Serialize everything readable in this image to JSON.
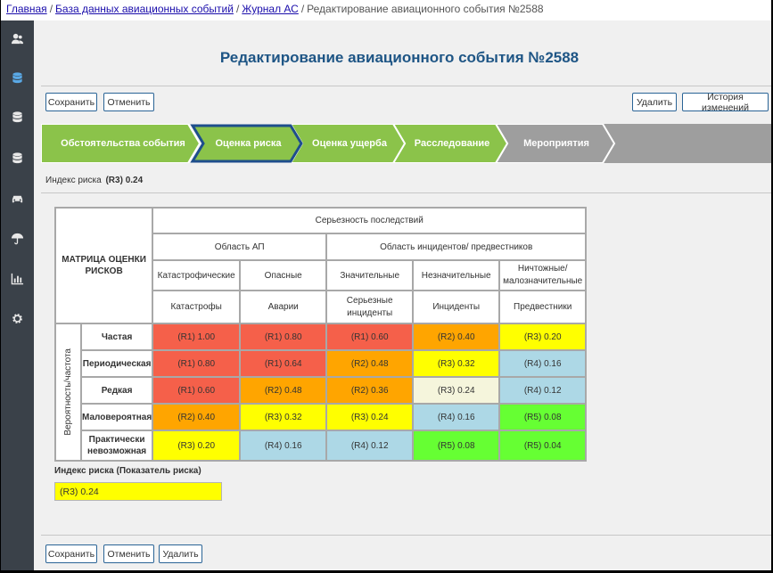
{
  "breadcrumb": {
    "items": [
      "Главная",
      "База данных авиационных событий",
      "Журнал АС"
    ],
    "current": "Редактирование авиационного события №2588"
  },
  "sidebar": {
    "icons": [
      "users-icon",
      "database-icon",
      "database-icon",
      "database-icon",
      "car-icon",
      "umbrella-icon",
      "chart-icon",
      "gear-icon"
    ]
  },
  "page": {
    "title": "Редактирование авиационного события №2588"
  },
  "toolbar": {
    "save": "Сохранить",
    "cancel": "Отменить",
    "delete": "Удалить",
    "history": "История изменений"
  },
  "steps": [
    {
      "label": "Обстоятельства события",
      "state": "done"
    },
    {
      "label": "Оценка риска",
      "state": "active"
    },
    {
      "label": "Оценка ущерба",
      "state": "done"
    },
    {
      "label": "Расследование",
      "state": "done"
    },
    {
      "label": "Мероприятия",
      "state": "pending"
    }
  ],
  "risk_index": {
    "label": "Индекс риска",
    "value": "(R3) 0.24"
  },
  "matrix": {
    "title": "МАТРИЦА ОЦЕНКИ РИСКОВ",
    "severity_header": "Серьезность последствий",
    "area_ap": "Область АП",
    "area_incidents": "Область инцидентов/ предвестников",
    "severity_cols": [
      "Катастрофические",
      "Опасные",
      "Значительные",
      "Незначительные",
      "Ничтожные/ малозначительные"
    ],
    "event_cols": [
      "Катастрофы",
      "Аварии",
      "Серьезные инциденты",
      "Инциденты",
      "Предвестники"
    ],
    "probability_label": "Вероятность/частота",
    "rows": [
      {
        "label": "Частая",
        "cells": [
          [
            "(R1) 1.00",
            "red"
          ],
          [
            "(R1) 0.80",
            "red"
          ],
          [
            "(R1) 0.60",
            "red"
          ],
          [
            "(R2) 0.40",
            "orange"
          ],
          [
            "(R3) 0.20",
            "yellow"
          ]
        ]
      },
      {
        "label": "Периодическая",
        "cells": [
          [
            "(R1) 0.80",
            "red"
          ],
          [
            "(R1) 0.64",
            "red"
          ],
          [
            "(R2) 0.48",
            "orange"
          ],
          [
            "(R3) 0.32",
            "yellow"
          ],
          [
            "(R4) 0.16",
            "blue"
          ]
        ]
      },
      {
        "label": "Редкая",
        "cells": [
          [
            "(R1) 0.60",
            "red"
          ],
          [
            "(R2) 0.48",
            "orange"
          ],
          [
            "(R2) 0.36",
            "orange"
          ],
          [
            "(R3) 0.24",
            "selected"
          ],
          [
            "(R4) 0.12",
            "blue"
          ]
        ]
      },
      {
        "label": "Маловероятная",
        "cells": [
          [
            "(R2) 0.40",
            "orange"
          ],
          [
            "(R3) 0.32",
            "yellow"
          ],
          [
            "(R3) 0.24",
            "yellow"
          ],
          [
            "(R4) 0.16",
            "blue"
          ],
          [
            "(R5) 0.08",
            "green"
          ]
        ]
      },
      {
        "label": "Практически невозможная",
        "cells": [
          [
            "(R3) 0.20",
            "yellow"
          ],
          [
            "(R4) 0.16",
            "blue"
          ],
          [
            "(R4) 0.12",
            "blue"
          ],
          [
            "(R5) 0.08",
            "green"
          ],
          [
            "(R5) 0.04",
            "green"
          ]
        ]
      }
    ]
  },
  "index_field": {
    "label": "Индекс риска (Показатель риска)",
    "value": "(R3) 0.24",
    "color": "#ffff00"
  },
  "colors": {
    "red": "#f5604a",
    "orange": "#ffa500",
    "yellow": "#ffff00",
    "blue": "#add8e6",
    "green": "#66ff33",
    "selected": "#f5f5dc",
    "step_done": "#8bc34a",
    "step_pending": "#9e9e9e",
    "step_active_border": "#1e4e8c",
    "title": "#1e5585"
  }
}
